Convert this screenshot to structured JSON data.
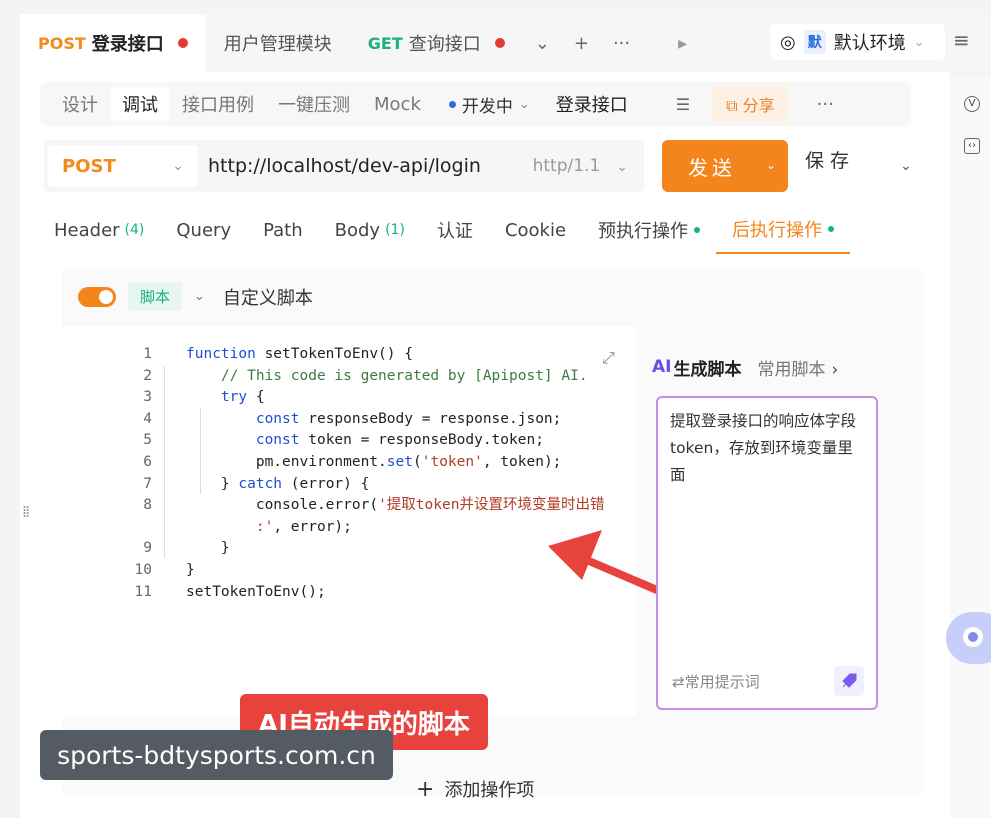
{
  "tabs": [
    {
      "method": "POST",
      "label": "登录接口",
      "unsaved": true
    },
    {
      "method": "",
      "label": "用户管理模块",
      "unsaved": false
    },
    {
      "method": "GET",
      "label": "查询接口",
      "unsaved": true
    }
  ],
  "tab_controls": {
    "dropdown": "⌄",
    "add": "+",
    "more": "···",
    "next": "▸"
  },
  "environment": {
    "badge": "默",
    "label": "默认环境"
  },
  "subnav": {
    "items": [
      "设计",
      "调试",
      "接口用例",
      "一键压测",
      "Mock"
    ],
    "active": "调试",
    "env_status": "开发中",
    "api_name": "登录接口",
    "share": "分享"
  },
  "request": {
    "method": "POST",
    "url": "http://localhost/dev-api/login",
    "protocol": "http/1.1",
    "send": "发送",
    "save": "保存"
  },
  "req_tabs": [
    {
      "label": "Header",
      "count": "(4)"
    },
    {
      "label": "Query"
    },
    {
      "label": "Path"
    },
    {
      "label": "Body",
      "count": "(1)"
    },
    {
      "label": "认证"
    },
    {
      "label": "Cookie"
    },
    {
      "label": "预执行操作",
      "dot": true
    },
    {
      "label": "后执行操作",
      "dot": true,
      "active": true
    }
  ],
  "script_card": {
    "tag": "脚本",
    "title": "自定义脚本"
  },
  "code_lines": [
    {
      "n": "1"
    },
    {
      "n": "2"
    },
    {
      "n": "3"
    },
    {
      "n": "4"
    },
    {
      "n": "5"
    },
    {
      "n": "6"
    },
    {
      "n": "7"
    },
    {
      "n": "8"
    },
    {
      "n": ""
    },
    {
      "n": "9"
    },
    {
      "n": "10"
    },
    {
      "n": "11"
    }
  ],
  "code": {
    "l1_kw": "function",
    "l1": " setTokenToEnv() {",
    "l2": "// This code is generated by [Apipost] AI.",
    "l3_kw": "try",
    "l3": " {",
    "l4_kw": "const",
    "l4": " responseBody = response.json;",
    "l5_kw": "const",
    "l5": " token = responseBody.token;",
    "l6a": "pm.environment.",
    "l6_fn": "set",
    "l6b": "(",
    "l6_str": "'token'",
    "l6c": ", token);",
    "l7a": "} ",
    "l7_kw": "catch",
    "l7b": " (error) {",
    "l8a": "console.error(",
    "l8_str": "'提取token并设置环境变量时出错",
    "l8b_str": ":'",
    "l8b": ", error);",
    "l9": "}",
    "l10": "}",
    "l11": "setTokenToEnv();"
  },
  "annotation": "AI自动生成的脚本",
  "ai_panel": {
    "ai_badge": "AI",
    "tab_generate": "生成脚本",
    "tab_common": "常用脚本",
    "prompt": "提取登录接口的响应体字段token，存放到环境变量里面",
    "hint": "常用提示词"
  },
  "add_operation": "添加操作项",
  "watermark": "sports-bdtysports.com.cn",
  "colors": {
    "accent": "#f4851c",
    "get": "#19b27b",
    "ai_border": "#c68de0",
    "annotation": "#e8423c"
  }
}
